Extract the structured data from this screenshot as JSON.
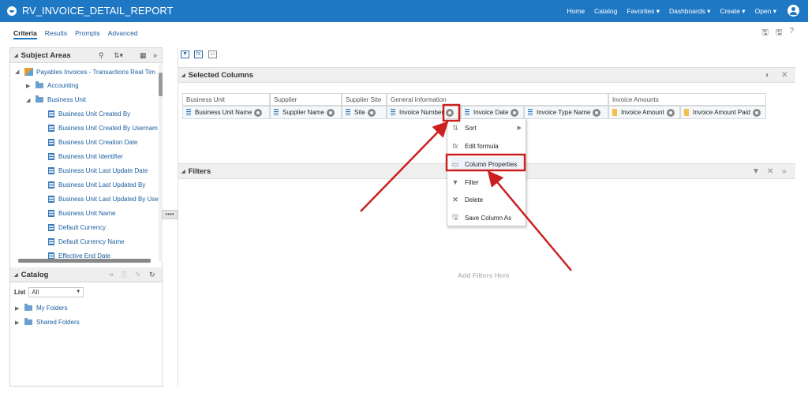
{
  "header": {
    "title": "RV_INVOICE_DETAIL_REPORT",
    "nav": [
      "Home",
      "Catalog",
      "Favorites ▾",
      "Dashboards ▾",
      "Create ▾",
      "Open ▾"
    ]
  },
  "tabs": [
    "Criteria",
    "Results",
    "Prompts",
    "Advanced"
  ],
  "subject_areas": {
    "title": "Subject Areas",
    "root": "Payables Invoices - Transactions Real Tim",
    "folders": [
      "Accounting",
      "Business Unit"
    ],
    "columns": [
      "Business Unit Created By",
      "Business Unit Created By Usernam",
      "Business Unit Creation Date",
      "Business Unit Identifier",
      "Business Unit Last Update Date",
      "Business Unit Last Updated By",
      "Business Unit Last Updated By Use",
      "Business Unit Name",
      "Default Currency",
      "Default Currency Name",
      "Effective End Date"
    ]
  },
  "catalog": {
    "title": "Catalog",
    "list_label": "List",
    "list_value": "All",
    "folders": [
      "My Folders",
      "Shared Folders"
    ]
  },
  "selected_columns": {
    "title": "Selected Columns",
    "groups": [
      "Business Unit",
      "Supplier",
      "Supplier Site",
      "General Information",
      "Invoice Amounts"
    ],
    "columns": [
      "Business Unit Name",
      "Supplier Name",
      "Site",
      "Invoice Number",
      "Invoice Date",
      "Invoice Type Name",
      "Invoice Amount",
      "Invoice Amount Paid"
    ]
  },
  "context_menu": [
    "Sort",
    "Edit formula",
    "Column Properties",
    "Filter",
    "Delete",
    "Save Column As"
  ],
  "filters": {
    "title": "Filters",
    "placeholder": "Add Filters Here"
  },
  "colors": {
    "topbar": "#1f78c4",
    "highlight": "#cc2020"
  }
}
